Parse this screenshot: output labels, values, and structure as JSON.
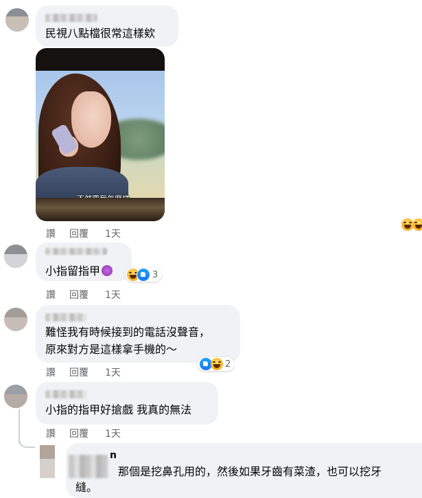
{
  "comments": [
    {
      "text": "民視八點檔很常這樣欸",
      "photo_subtitle": "不然要我怎麼樣",
      "actions": [
        "讚",
        "回覆",
        "1天"
      ]
    },
    {
      "name_partial": "....",
      "text": "小指留指甲",
      "reaction_count": "3",
      "actions": [
        "讚",
        "回覆",
        "1天"
      ]
    },
    {
      "text_line1": "難怪我有時候接到的電話沒聲音，",
      "text_line2": "原來對方是這樣拿手機的～",
      "reaction_count": "2",
      "actions": [
        "讚",
        "回覆",
        "1天"
      ]
    },
    {
      "text": "小指的指甲好搶戲 我真的無法",
      "actions": [
        "讚",
        "回覆",
        "1天"
      ]
    },
    {
      "name_partial": "n",
      "text_line1": "那個是挖鼻孔用的，然後如果牙齒有菜渣，也可以挖牙",
      "text_line2": "縫。"
    }
  ],
  "colors": {
    "bubble": "#f0f2f5",
    "meta_text": "#65676b",
    "like_blue": "#1877f2",
    "haha_yellow": "#f7b125"
  },
  "icons": [
    "haha-emoji-icon",
    "like-icon",
    "purple-emoji-icon"
  ]
}
